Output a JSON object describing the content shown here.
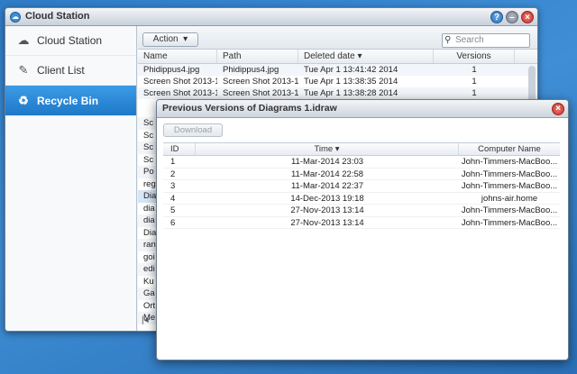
{
  "window": {
    "title": "Cloud Station",
    "icon": "cloud-app-icon",
    "help": "?",
    "minimize": "–",
    "close": "×"
  },
  "sidebar": {
    "items": [
      {
        "label": "Cloud Station",
        "icon": "cloud-icon",
        "active": false
      },
      {
        "label": "Client List",
        "icon": "client-list-icon",
        "active": false
      },
      {
        "label": "Recycle Bin",
        "icon": "recycle-bin-icon",
        "active": true
      }
    ]
  },
  "toolbar": {
    "action_label": "Action",
    "search_placeholder": "Search"
  },
  "table": {
    "headers": [
      "Name",
      "Path",
      "Deleted date",
      "Versions"
    ],
    "rows": [
      [
        "Phidippus4.jpg",
        "Phidippus4.jpg",
        "Tue Apr 1 13:41:42 2014",
        "1"
      ],
      [
        "Screen Shot 2013-10...",
        "Screen Shot 2013-10...",
        "Tue Apr 1 13:38:35 2014",
        "1"
      ],
      [
        "Screen Shot 2013-10...",
        "Screen Shot 2013-10...",
        "Tue Apr 1 13:38:28 2014",
        "1"
      ]
    ],
    "partial_names": [
      "Sc",
      "Sc",
      "Sc",
      "Sc",
      "Po",
      "reg",
      "Dia",
      "dia",
      "dia",
      "Dia",
      "ran",
      "goi",
      "edi",
      "Ku",
      "Ga",
      "Ort",
      "Me"
    ],
    "pager": "|◂"
  },
  "dialog": {
    "title": "Previous Versions of Diagrams 1.idraw",
    "close": "×",
    "download_label": "Download",
    "headers": {
      "id": "ID",
      "time": "Time",
      "computer": "Computer Name"
    },
    "rows": [
      {
        "id": "1",
        "time": "11-Mar-2014 23:03",
        "computer": "John-Timmers-MacBoo..."
      },
      {
        "id": "2",
        "time": "11-Mar-2014 22:58",
        "computer": "John-Timmers-MacBoo..."
      },
      {
        "id": "3",
        "time": "11-Mar-2014 22:37",
        "computer": "John-Timmers-MacBoo..."
      },
      {
        "id": "4",
        "time": "14-Dec-2013 19:18",
        "computer": "johns-air.home"
      },
      {
        "id": "5",
        "time": "27-Nov-2013 13:14",
        "computer": "John-Timmers-MacBoo..."
      },
      {
        "id": "6",
        "time": "27-Nov-2013 13:14",
        "computer": "John-Timmers-MacBoo..."
      }
    ]
  }
}
